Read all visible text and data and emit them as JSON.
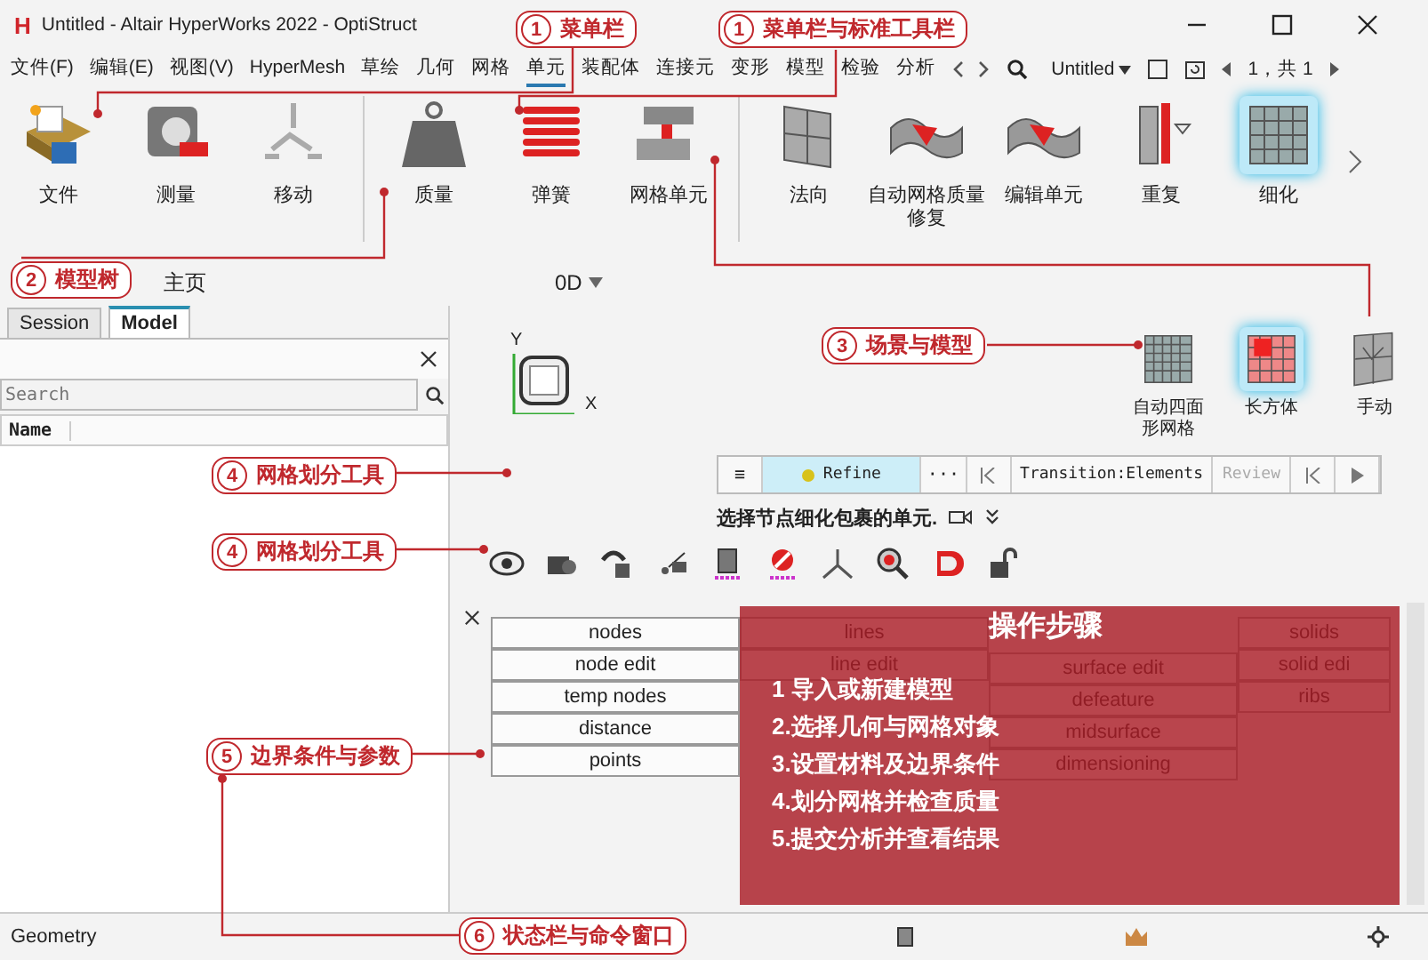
{
  "window": {
    "logo": "H",
    "title": "Untitled - Altair HyperWorks 2022 - OptiStruct"
  },
  "menu": [
    {
      "label": "文件(F)",
      "selected": false
    },
    {
      "label": "编辑(E)",
      "selected": false
    },
    {
      "label": "视图(V)",
      "selected": false
    },
    {
      "label": "HyperMesh",
      "selected": false
    },
    {
      "label": "草绘",
      "selected": false
    },
    {
      "label": "几何",
      "selected": false
    },
    {
      "label": "网格",
      "selected": false
    },
    {
      "label": "单元",
      "selected": true
    },
    {
      "label": "装配体",
      "selected": false
    },
    {
      "label": "连接元",
      "selected": false
    },
    {
      "label": "变形",
      "selected": false
    },
    {
      "label": "模型",
      "selected": false
    },
    {
      "label": "检验",
      "selected": false
    },
    {
      "label": "分析",
      "selected": false
    }
  ],
  "menu_tools": {
    "document": "Untitled",
    "page": "1，共 1"
  },
  "ribbon": {
    "groups": [
      {
        "items": [
          {
            "label": "文件",
            "selected": false
          },
          {
            "label": "测量",
            "selected": false
          },
          {
            "label": "移动",
            "selected": false
          }
        ]
      },
      {
        "items": [
          {
            "label": "质量",
            "selected": false
          },
          {
            "label": "弹簧",
            "selected": false
          },
          {
            "label": "网格单元",
            "selected": false
          }
        ]
      },
      {
        "items": [
          {
            "label": "法向",
            "selected": false
          },
          {
            "label": "自动网格质量修复",
            "selected": false
          },
          {
            "label": "编辑单元",
            "selected": false
          },
          {
            "label": "重复",
            "selected": false
          },
          {
            "label": "细化",
            "selected": true
          }
        ]
      }
    ]
  },
  "home_tab": "主页",
  "view_mode": "0D",
  "model_browser": {
    "tabs": [
      {
        "label": "Session",
        "selected": false
      },
      {
        "label": "Model",
        "selected": true
      }
    ],
    "search": {
      "placeholder": "Search"
    },
    "column": "Name"
  },
  "axes": {
    "y": "Y",
    "x": "X"
  },
  "mesh_tools": [
    {
      "label": "自动四面形网格",
      "selected": false
    },
    {
      "label": "长方体",
      "selected": true
    },
    {
      "label": "手动",
      "selected": false
    }
  ],
  "toolbar": [
    {
      "kind": "glyph",
      "label": "≡"
    },
    {
      "kind": "tool",
      "label": "Refine",
      "active": true,
      "disabled": false
    },
    {
      "kind": "glyph",
      "label": "···"
    },
    {
      "kind": "first"
    },
    {
      "kind": "tool",
      "label": "Transition:Elements",
      "active": false,
      "disabled": false
    },
    {
      "kind": "tool",
      "label": "Review",
      "active": false,
      "disabled": true
    },
    {
      "kind": "first"
    },
    {
      "kind": "play"
    }
  ],
  "prompt": "选择节点细化包裹的单元.",
  "panel": {
    "columns": [
      {
        "kind": "plain",
        "buttons": [
          "nodes",
          "node edit",
          "temp nodes",
          "distance",
          "points"
        ]
      },
      {
        "kind": "plain",
        "buttons": [
          "lines",
          "line edit"
        ]
      },
      {
        "kind": "under-heading",
        "buttons": [
          "surface edit",
          "defeature",
          "midsurface",
          "dimensioning"
        ]
      },
      {
        "kind": "plain",
        "buttons": [
          "solids",
          "solid edi",
          "ribs"
        ]
      }
    ]
  },
  "steps_overlay": {
    "title": "操作步骤",
    "steps": [
      "1 导入或新建模型",
      "2.选择几何与网格对象",
      "3.设置材料及边界条件",
      "4.划分网格并检查质量",
      "5.提交分析并查看结果"
    ]
  },
  "status_bar": {
    "mode": "Geometry"
  },
  "callouts": [
    {
      "number": "1",
      "text": "菜单栏"
    },
    {
      "number": "1",
      "text": "菜单栏与标准工具栏"
    },
    {
      "number": "2",
      "text": "模型树"
    },
    {
      "number": "3",
      "text": "场景与模型"
    },
    {
      "number": "4",
      "text": "网格划分工具"
    },
    {
      "number": "4",
      "text": "网格划分工具"
    },
    {
      "number": "5",
      "text": "边界条件与参数"
    },
    {
      "number": "6",
      "text": "状态栏与命令窗口"
    }
  ]
}
